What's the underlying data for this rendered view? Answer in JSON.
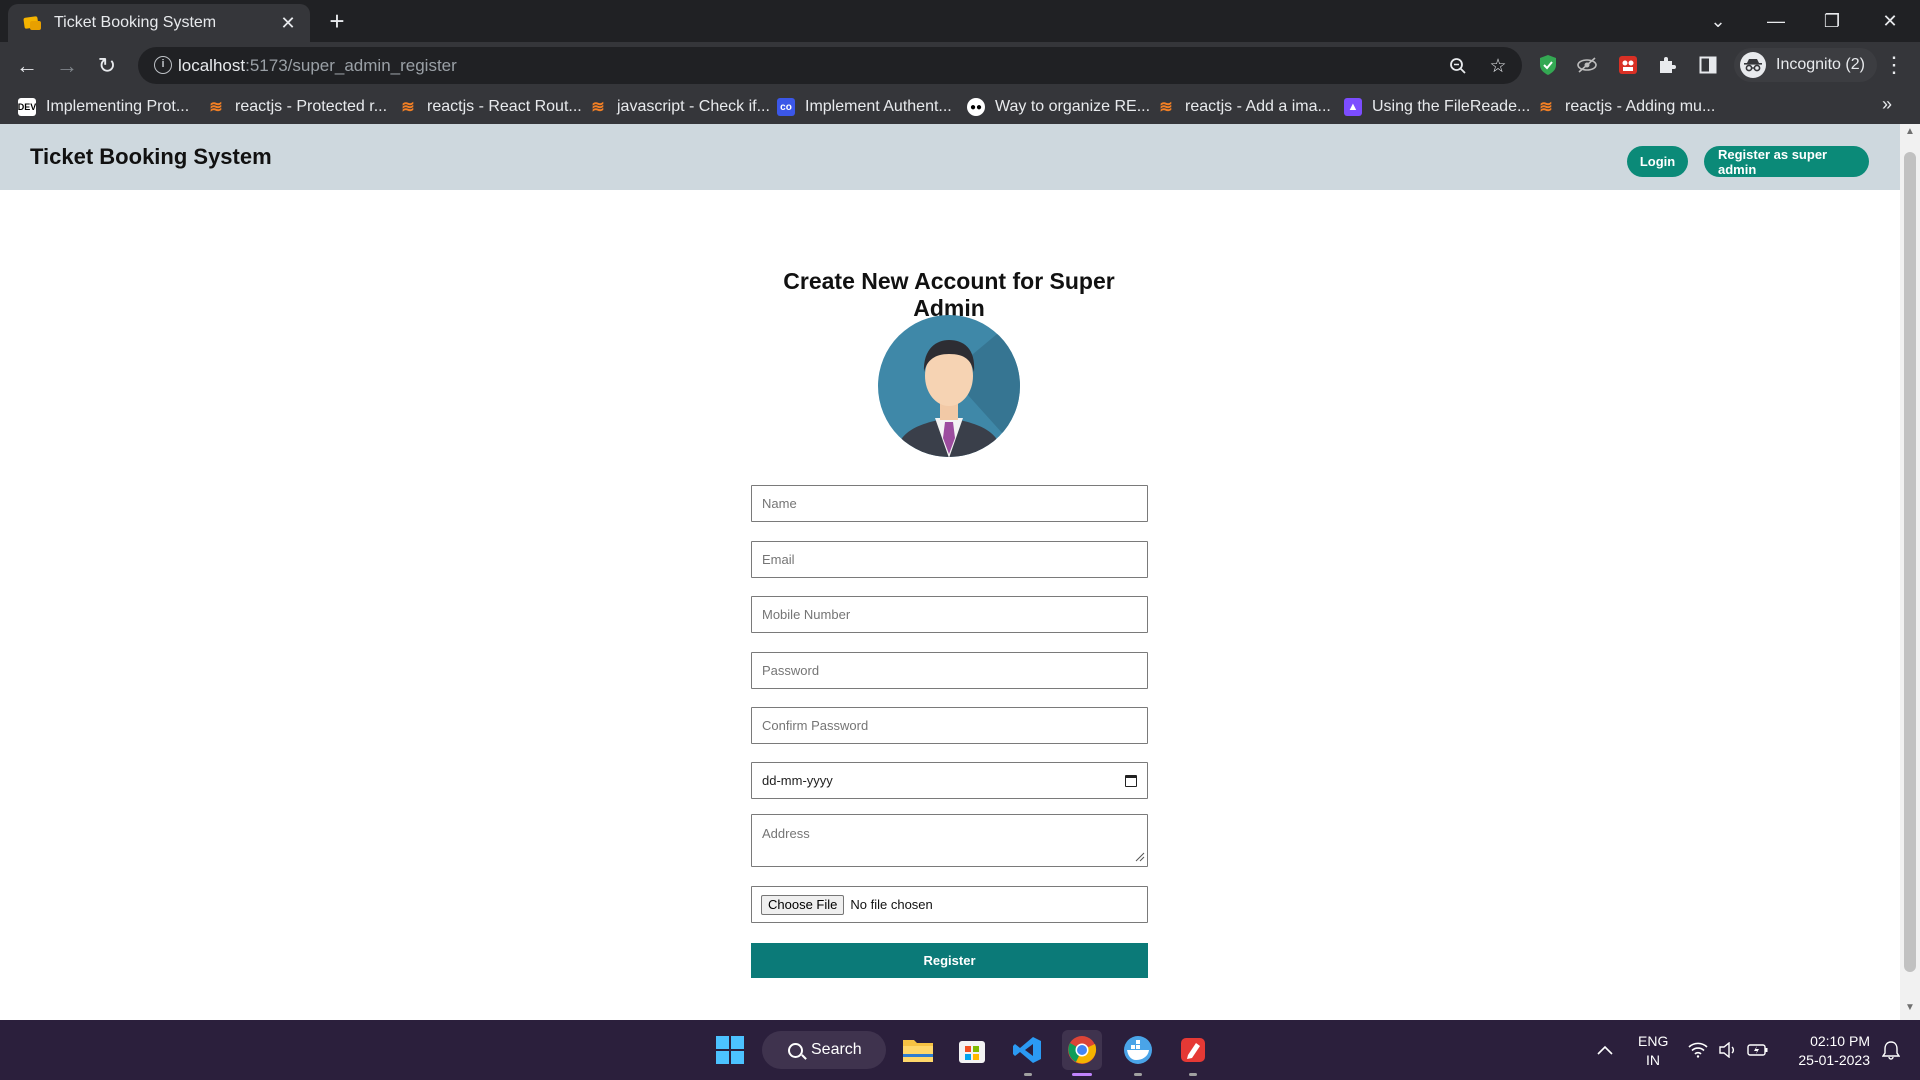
{
  "browser": {
    "tab_title": "Ticket Booking System",
    "url_host": "localhost",
    "url_path": ":5173/super_admin_register",
    "profile_label": "Incognito (2)",
    "bookmarks": [
      {
        "icon": "dev-icon",
        "label": "Implementing Prot..."
      },
      {
        "icon": "stackoverflow-icon",
        "label": "reactjs - Protected r..."
      },
      {
        "icon": "stackoverflow-icon",
        "label": "reactjs - React Rout..."
      },
      {
        "icon": "stackoverflow-icon",
        "label": "javascript - Check if..."
      },
      {
        "icon": "codeinfinity-icon",
        "label": "Implement Authent..."
      },
      {
        "icon": "medium-icon",
        "label": "Way to organize RE..."
      },
      {
        "icon": "stackoverflow-icon",
        "label": "reactjs - Add a ima..."
      },
      {
        "icon": "purple-app-icon",
        "label": "Using the FileReade..."
      },
      {
        "icon": "stackoverflow-icon",
        "label": "reactjs - Adding mu..."
      }
    ]
  },
  "app": {
    "brand": "Ticket Booking System",
    "nav": {
      "login_label": "Login",
      "register_label": "Register as super admin"
    },
    "form": {
      "title": "Create New Account for Super Admin",
      "name_placeholder": "Name",
      "email_placeholder": "Email",
      "mobile_placeholder": "Mobile Number",
      "password_placeholder": "Password",
      "confirm_password_placeholder": "Confirm Password",
      "date_value": "dd-mm-yyyy",
      "address_placeholder": "Address",
      "file_button": "Choose File",
      "file_status": "No file chosen",
      "submit_label": "Register"
    },
    "accent_color": "#0b7a78"
  },
  "taskbar": {
    "search_label": "Search",
    "lang_line1": "ENG",
    "lang_line2": "IN",
    "time": "02:10 PM",
    "date": "25-01-2023"
  }
}
